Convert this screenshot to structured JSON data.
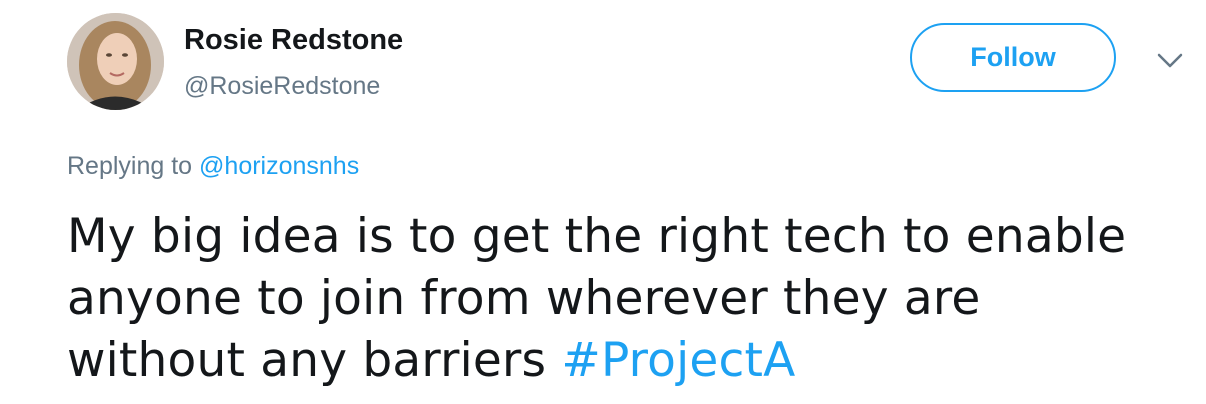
{
  "tweet": {
    "author": {
      "display_name": "Rosie Redstone",
      "handle": "@RosieRedstone"
    },
    "follow_label": "Follow",
    "replying_prefix": "Replying to ",
    "replying_to": "@horizonsnhs",
    "text_lines": [
      "My big idea is to get the right tech to enable",
      "anyone to join from wherever they are",
      "without any barriers "
    ],
    "hashtag": "#ProjectA"
  },
  "colors": {
    "accent": "#1da1f2",
    "muted": "#657786",
    "text": "#14171a"
  },
  "icons": {
    "avatar": "user-photo",
    "caret": "chevron-down-icon"
  }
}
